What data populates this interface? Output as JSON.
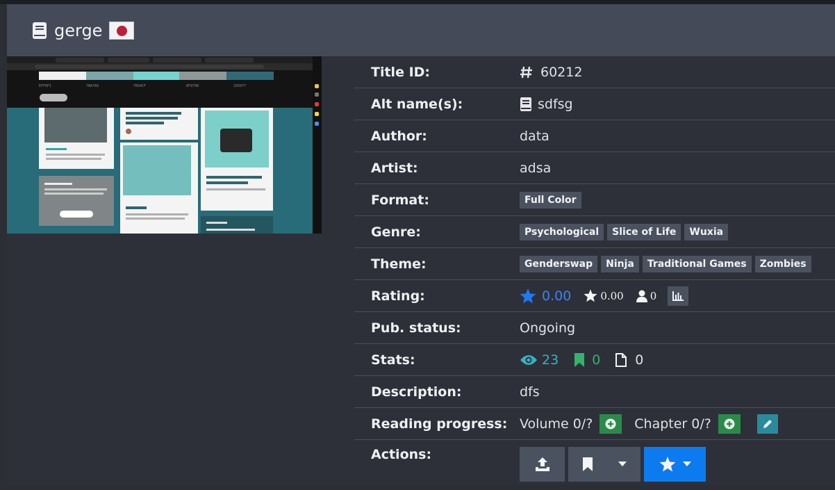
{
  "header": {
    "title": "gerge",
    "flag": "japan-flag"
  },
  "thumbnail": {
    "palette": [
      "#EFF0F1",
      "#7BA7A9",
      "#76D4CF",
      "#8F9798",
      "#326977"
    ],
    "palette_labels": [
      "EFF0F1",
      "7BA7A9",
      "76D4CF",
      "8F9798",
      "326977"
    ]
  },
  "details": {
    "title_id": {
      "label": "Title ID:",
      "value": "60212"
    },
    "alt_names": {
      "label": "Alt name(s):",
      "value": "sdfsg"
    },
    "author": {
      "label": "Author:",
      "value": "data"
    },
    "artist": {
      "label": "Artist:",
      "value": "adsa"
    },
    "format": {
      "label": "Format:",
      "tags": [
        "Full Color"
      ]
    },
    "genre": {
      "label": "Genre:",
      "tags": [
        "Psychological",
        "Slice of Life",
        "Wuxia"
      ]
    },
    "theme": {
      "label": "Theme:",
      "tags": [
        "Genderswap",
        "Ninja",
        "Traditional Games",
        "Zombies"
      ]
    },
    "rating": {
      "label": "Rating:",
      "bayesian": "0.00",
      "mean": "0.00",
      "users": "0"
    },
    "pub_status": {
      "label": "Pub. status:",
      "value": "Ongoing"
    },
    "stats": {
      "label": "Stats:",
      "views": "23",
      "follows": "0",
      "comments": "0"
    },
    "description": {
      "label": "Description:",
      "value": "dfs"
    },
    "reading_progress": {
      "label": "Reading progress:",
      "volume": "Volume 0/?",
      "chapter": "Chapter 0/?"
    },
    "actions": {
      "label": "Actions:"
    }
  },
  "colors": {
    "accent_blue": "#0d7bf0",
    "tag_bg": "#4a5260",
    "green": "#2b8a4a",
    "teal": "#2a8a9c"
  }
}
